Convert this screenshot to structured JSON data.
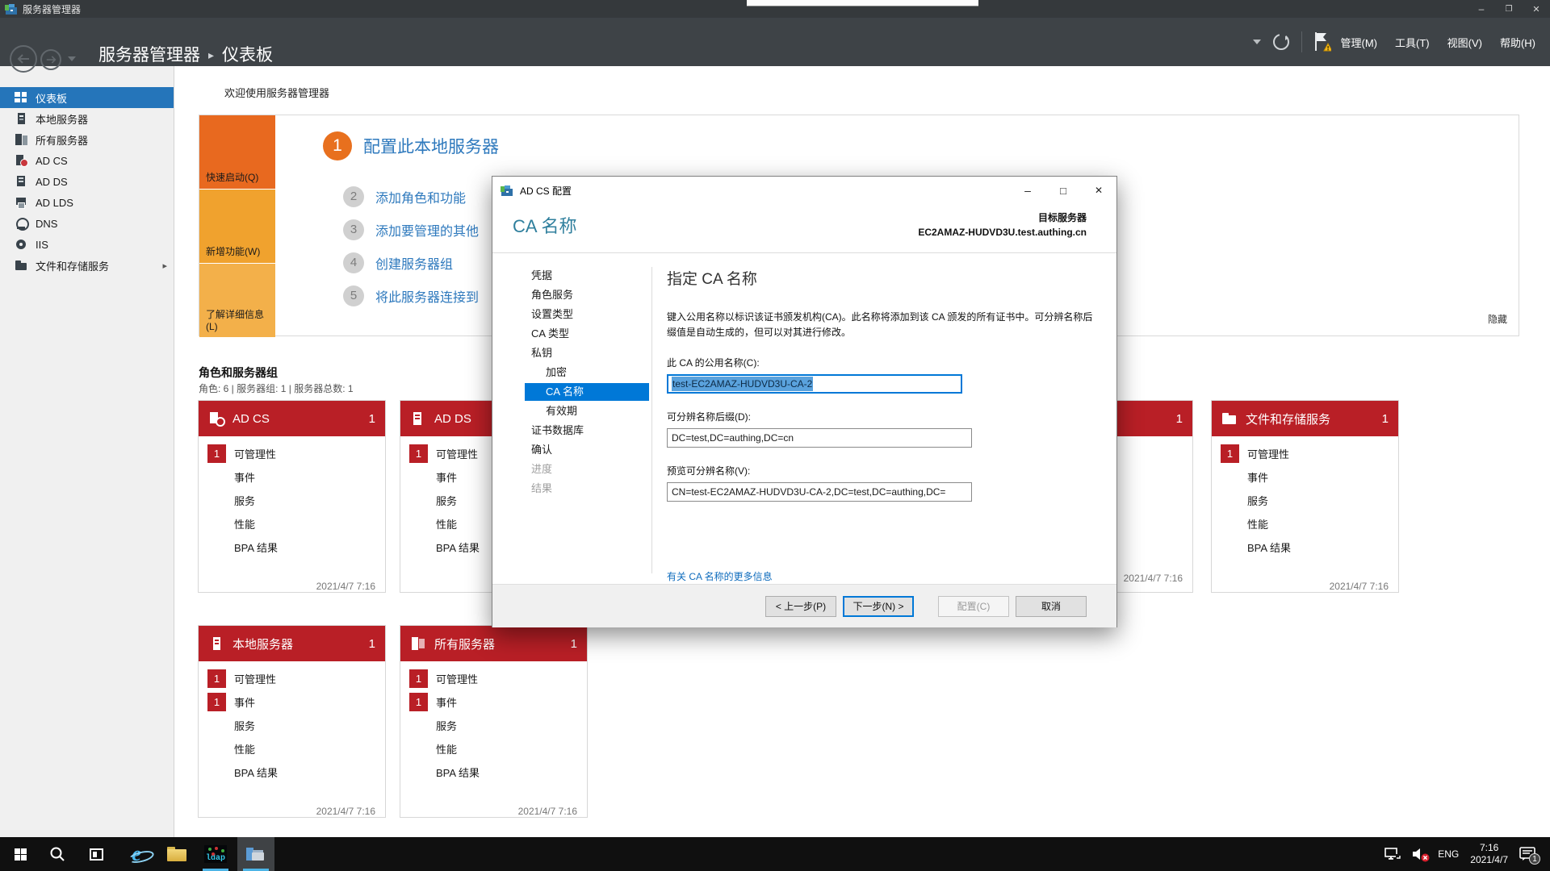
{
  "titlebar": {
    "title": "服务器管理器"
  },
  "nav": {
    "breadcrumb_root": "服务器管理器",
    "breadcrumb_sep": "▸",
    "breadcrumb_current": "仪表板",
    "menu": [
      {
        "id": "manage",
        "label": "管理(M)"
      },
      {
        "id": "tools",
        "label": "工具(T)"
      },
      {
        "id": "view",
        "label": "视图(V)"
      },
      {
        "id": "help",
        "label": "帮助(H)"
      }
    ]
  },
  "sidebar": {
    "items": [
      {
        "id": "dashboard",
        "label": "仪表板",
        "icon": "ic-dashboard",
        "selected": true
      },
      {
        "id": "local-server",
        "label": "本地服务器",
        "icon": "ic-server",
        "selected": false
      },
      {
        "id": "all-servers",
        "label": "所有服务器",
        "icon": "ic-servers",
        "selected": false
      },
      {
        "id": "ad-cs",
        "label": "AD CS",
        "icon": "ic-adcs",
        "selected": false
      },
      {
        "id": "ad-ds",
        "label": "AD DS",
        "icon": "ic-adds",
        "selected": false
      },
      {
        "id": "ad-lds",
        "label": "AD LDS",
        "icon": "ic-adlds",
        "selected": false
      },
      {
        "id": "dns",
        "label": "DNS",
        "icon": "ic-dns",
        "selected": false
      },
      {
        "id": "iis",
        "label": "IIS",
        "icon": "ic-iis",
        "selected": false
      },
      {
        "id": "file-storage",
        "label": "文件和存储服务",
        "icon": "ic-files",
        "selected": false,
        "flyout": "▸"
      }
    ]
  },
  "dashboard": {
    "welcome_heading": "欢迎使用服务器管理器",
    "tile": {
      "quick_start": "快速启动(Q)",
      "whats_new": "新增功能(W)",
      "learn_more": "了解详细信息(L)"
    },
    "steps": [
      {
        "num": "1",
        "label": "配置此本地服务器"
      },
      {
        "num": "2",
        "label": "添加角色和功能"
      },
      {
        "num": "3",
        "label": "添加要管理的其他"
      },
      {
        "num": "4",
        "label": "创建服务器组"
      },
      {
        "num": "5",
        "label": "将此服务器连接到"
      }
    ],
    "hide_link": "隐藏",
    "roles_heading": "角色和服务器组",
    "roles_summary": "角色: 6 | 服务器组: 1 | 服务器总数: 1"
  },
  "cards": [
    {
      "id": "ad-cs",
      "label": "AD CS",
      "count": "1",
      "icon": "wic-cert",
      "rows": [
        {
          "badge": "1",
          "label": "可管理性"
        },
        {
          "badge": "",
          "label": "事件"
        },
        {
          "badge": "",
          "label": "服务"
        },
        {
          "badge": "",
          "label": "性能"
        },
        {
          "badge": "",
          "label": "BPA 结果"
        }
      ],
      "date": "2021/4/7 7:16"
    },
    {
      "id": "ad-ds",
      "label": "AD DS",
      "count": "",
      "icon": "wic-adds",
      "rows": [
        {
          "badge": "1",
          "label": "可管理性"
        },
        {
          "badge": "",
          "label": "事件"
        },
        {
          "badge": "",
          "label": "服务"
        },
        {
          "badge": "",
          "label": "性能"
        },
        {
          "badge": "",
          "label": "BPA 结果"
        }
      ],
      "date": ""
    },
    {
      "id": "hidden",
      "label": "",
      "count": "1",
      "icon": "",
      "rows": [],
      "date": "2021/4/7 7:16"
    },
    {
      "id": "files",
      "label": "文件和存储服务",
      "count": "1",
      "icon": "wic-folder",
      "rows": [
        {
          "badge": "1",
          "label": "可管理性"
        },
        {
          "badge": "",
          "label": "事件"
        },
        {
          "badge": "",
          "label": "服务"
        },
        {
          "badge": "",
          "label": "性能"
        },
        {
          "badge": "",
          "label": "BPA 结果"
        }
      ],
      "date": "2021/4/7 7:16"
    },
    {
      "id": "local",
      "label": "本地服务器",
      "count": "1",
      "icon": "wic-server",
      "rows": [
        {
          "badge": "1",
          "label": "可管理性"
        },
        {
          "badge": "1",
          "label": "事件"
        },
        {
          "badge": "",
          "label": "服务"
        },
        {
          "badge": "",
          "label": "性能"
        },
        {
          "badge": "",
          "label": "BPA 结果"
        }
      ],
      "date": "2021/4/7 7:16"
    },
    {
      "id": "all",
      "label": "所有服务器",
      "count": "1",
      "icon": "wic-servers",
      "rows": [
        {
          "badge": "1",
          "label": "可管理性"
        },
        {
          "badge": "1",
          "label": "事件"
        },
        {
          "badge": "",
          "label": "服务"
        },
        {
          "badge": "",
          "label": "性能"
        },
        {
          "badge": "",
          "label": "BPA 结果"
        }
      ],
      "date": "2021/4/7 7:16"
    }
  ],
  "dialog": {
    "title": "AD CS 配置",
    "heading": "CA 名称",
    "target_label": "目标服务器",
    "target_server": "EC2AMAZ-HUDVD3U.test.authing.cn",
    "steps": [
      {
        "id": "credentials",
        "label": "凭据",
        "state": "normal",
        "indent": false
      },
      {
        "id": "role-services",
        "label": "角色服务",
        "state": "normal",
        "indent": false
      },
      {
        "id": "setup-type",
        "label": "设置类型",
        "state": "normal",
        "indent": false
      },
      {
        "id": "ca-type",
        "label": "CA 类型",
        "state": "normal",
        "indent": false
      },
      {
        "id": "private-key",
        "label": "私钥",
        "state": "normal",
        "indent": false
      },
      {
        "id": "cryptography",
        "label": "加密",
        "state": "normal",
        "indent": true
      },
      {
        "id": "ca-name",
        "label": "CA 名称",
        "state": "selected",
        "indent": true
      },
      {
        "id": "validity-period",
        "label": "有效期",
        "state": "normal",
        "indent": true
      },
      {
        "id": "certificate-database",
        "label": "证书数据库",
        "state": "normal",
        "indent": false
      },
      {
        "id": "confirmation",
        "label": "确认",
        "state": "normal",
        "indent": false
      },
      {
        "id": "progress",
        "label": "进度",
        "state": "disabled",
        "indent": false
      },
      {
        "id": "results",
        "label": "结果",
        "state": "disabled",
        "indent": false
      }
    ],
    "content": {
      "heading": "指定 CA 名称",
      "description": "键入公用名称以标识该证书颁发机构(CA)。此名称将添加到该 CA 颁发的所有证书中。可分辨名称后缀值是自动生成的，但可以对其进行修改。",
      "fields": [
        {
          "id": "common-name",
          "label": "此 CA 的公用名称(C):",
          "value": "test-EC2AMAZ-HUDVD3U-CA-2",
          "selected": true,
          "focused": true
        },
        {
          "id": "dn-suffix",
          "label": "可分辨名称后缀(D):",
          "value": "DC=test,DC=authing,DC=cn",
          "selected": false,
          "focused": false
        },
        {
          "id": "dn-preview",
          "label": "预览可分辨名称(V):",
          "value": "CN=test-EC2AMAZ-HUDVD3U-CA-2,DC=test,DC=authing,DC=",
          "selected": false,
          "focused": false
        }
      ],
      "link": "有关 CA 名称的更多信息"
    },
    "buttons": [
      {
        "id": "previous",
        "label": "< 上一步(P)",
        "state": "normal"
      },
      {
        "id": "next",
        "label": "下一步(N) >",
        "state": "focused"
      },
      {
        "id": "configure",
        "label": "配置(C)",
        "state": "disabled"
      },
      {
        "id": "cancel",
        "label": "取消",
        "state": "normal"
      }
    ]
  },
  "taskbar": {
    "apps": [
      {
        "id": "start",
        "icon": "start",
        "open": false,
        "active": false
      },
      {
        "id": "search",
        "icon": "search",
        "open": false,
        "active": false
      },
      {
        "id": "task-view",
        "icon": "taskview",
        "open": false,
        "active": false
      },
      {
        "id": "internet-explorer",
        "icon": "ie",
        "open": false,
        "active": false
      },
      {
        "id": "file-explorer",
        "icon": "folder",
        "open": false,
        "active": false
      },
      {
        "id": "ldap-tool",
        "icon": "ldap",
        "open": true,
        "active": false
      },
      {
        "id": "server-manager",
        "icon": "sm",
        "open": true,
        "active": true
      }
    ],
    "tray": {
      "lang": "ENG",
      "time": "7:16",
      "date": "2021/4/7",
      "badge": "1"
    }
  }
}
